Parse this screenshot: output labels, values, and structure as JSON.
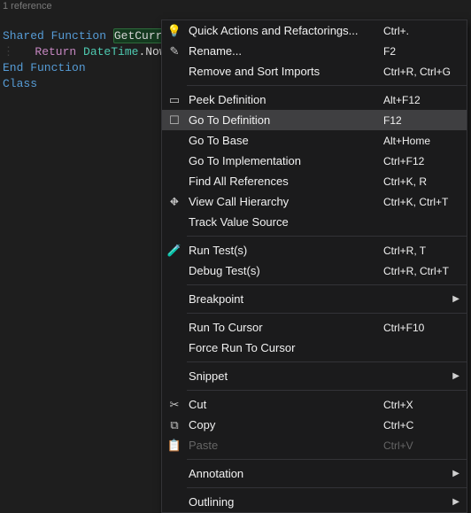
{
  "reference_hint": "1 reference",
  "code": {
    "line1_prefix": "Shared Function",
    "line1_method": "GetCurre",
    "line2_keyword": "Return",
    "line2_class": "DateTime",
    "line2_member": ".Now",
    "line3": "End Function",
    "line4": "Class"
  },
  "menu": {
    "items": [
      {
        "icon": "lightbulb-icon",
        "glyph": "💡",
        "label": "Quick Actions and Refactorings...",
        "shortcut": "Ctrl+."
      },
      {
        "icon": "rename-icon",
        "glyph": "✎",
        "label": "Rename...",
        "shortcut": "F2"
      },
      {
        "icon": "",
        "glyph": "",
        "label": "Remove and Sort Imports",
        "shortcut": "Ctrl+R, Ctrl+G"
      },
      {
        "sep": true
      },
      {
        "icon": "peek-icon",
        "glyph": "▭",
        "label": "Peek Definition",
        "shortcut": "Alt+F12"
      },
      {
        "icon": "goto-icon",
        "glyph": "☐",
        "label": "Go To Definition",
        "shortcut": "F12",
        "highlighted": true
      },
      {
        "icon": "",
        "glyph": "",
        "label": "Go To Base",
        "shortcut": "Alt+Home"
      },
      {
        "icon": "",
        "glyph": "",
        "label": "Go To Implementation",
        "shortcut": "Ctrl+F12"
      },
      {
        "icon": "",
        "glyph": "",
        "label": "Find All References",
        "shortcut": "Ctrl+K, R"
      },
      {
        "icon": "hierarchy-icon",
        "glyph": "⛖",
        "label": "View Call Hierarchy",
        "shortcut": "Ctrl+K, Ctrl+T"
      },
      {
        "icon": "",
        "glyph": "",
        "label": "Track Value Source",
        "shortcut": ""
      },
      {
        "sep": true
      },
      {
        "icon": "run-test-icon",
        "glyph": "🧪",
        "label": "Run Test(s)",
        "shortcut": "Ctrl+R, T"
      },
      {
        "icon": "",
        "glyph": "",
        "label": "Debug Test(s)",
        "shortcut": "Ctrl+R, Ctrl+T"
      },
      {
        "sep": true
      },
      {
        "icon": "",
        "glyph": "",
        "label": "Breakpoint",
        "shortcut": "",
        "submenu": true
      },
      {
        "sep": true
      },
      {
        "icon": "",
        "glyph": "",
        "label": "Run To Cursor",
        "shortcut": "Ctrl+F10"
      },
      {
        "icon": "",
        "glyph": "",
        "label": "Force Run To Cursor",
        "shortcut": ""
      },
      {
        "sep": true
      },
      {
        "icon": "",
        "glyph": "",
        "label": "Snippet",
        "shortcut": "",
        "submenu": true
      },
      {
        "sep": true
      },
      {
        "icon": "cut-icon",
        "glyph": "✂",
        "label": "Cut",
        "shortcut": "Ctrl+X"
      },
      {
        "icon": "copy-icon",
        "glyph": "⧉",
        "label": "Copy",
        "shortcut": "Ctrl+C"
      },
      {
        "icon": "paste-icon",
        "glyph": "📋",
        "label": "Paste",
        "shortcut": "Ctrl+V",
        "disabled": true
      },
      {
        "sep": true
      },
      {
        "icon": "",
        "glyph": "",
        "label": "Annotation",
        "shortcut": "",
        "submenu": true
      },
      {
        "sep": true
      },
      {
        "icon": "",
        "glyph": "",
        "label": "Outlining",
        "shortcut": "",
        "submenu": true
      }
    ]
  }
}
